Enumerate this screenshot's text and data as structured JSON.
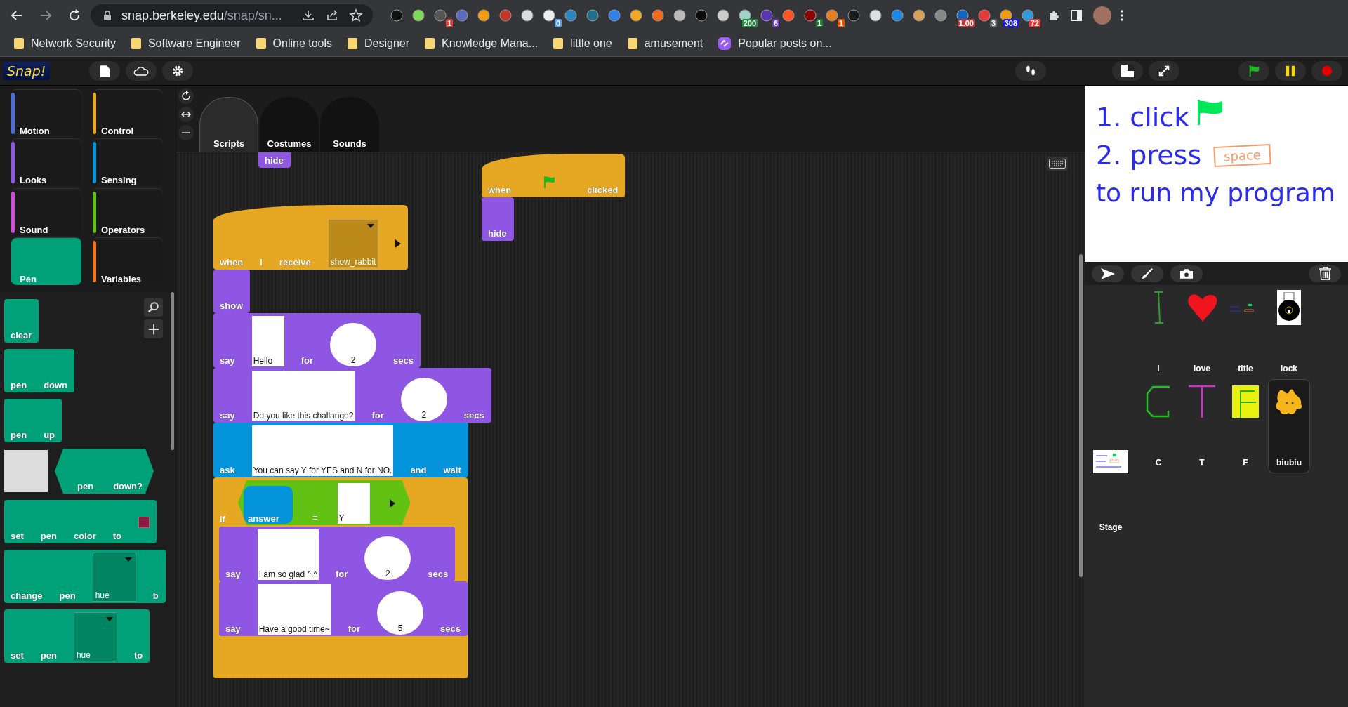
{
  "browser": {
    "url_host": "snap.berkeley.edu",
    "url_path": "/snap/sn...",
    "extensions": [
      {
        "color": "#111111"
      },
      {
        "color": "#7ed957"
      },
      {
        "color": "#555555",
        "badge": {
          "text": "1",
          "color": "#e53935"
        }
      },
      {
        "color": "#5b6bbf"
      },
      {
        "color": "#f39c12"
      },
      {
        "color": "#c0392b"
      },
      {
        "color": "#dddddd"
      },
      {
        "color": "#eeeeee",
        "badge": {
          "text": "0",
          "color": "#5b9bf0"
        }
      },
      {
        "color": "#2e86c1"
      },
      {
        "color": "#1f6f8b"
      },
      {
        "color": "#2f80ed"
      },
      {
        "color": "#f5a623"
      },
      {
        "color": "#f26b1d"
      },
      {
        "color": "#bbbbbb"
      },
      {
        "color": "#0a0a0a"
      },
      {
        "color": "#cccccc"
      },
      {
        "color": "#9fd3c7",
        "badge": {
          "text": "200",
          "color": "#1e8e3e"
        }
      },
      {
        "color": "#5e35b1",
        "badge": {
          "text": "6",
          "color": "#6a3fc1"
        }
      },
      {
        "color": "#ff5722"
      },
      {
        "color": "#8b0000",
        "badge": {
          "text": "1",
          "color": "#1e7e34"
        }
      },
      {
        "color": "#e67e22",
        "badge": {
          "text": "1",
          "color": "#e65100"
        }
      },
      {
        "color": "#1a1a1a"
      },
      {
        "color": "#e0e0e0"
      },
      {
        "color": "#1e88e5"
      },
      {
        "color": "#d4a05a"
      },
      {
        "color": "#888888"
      },
      {
        "color": "#1565c0",
        "badge": {
          "text": "1.00",
          "color": "#b03a3a"
        }
      },
      {
        "color": "#e53935",
        "badge": {
          "text": "3",
          "color": "#616161"
        }
      },
      {
        "color": "#f39c12",
        "badge": {
          "text": "308",
          "color": "#1a1aff"
        }
      },
      {
        "color": "#3498db",
        "badge": {
          "text": "72",
          "color": "#e53935"
        }
      }
    ],
    "bookmarks": [
      {
        "label": "Network Security",
        "kind": "folder"
      },
      {
        "label": "Software Engineer",
        "kind": "folder"
      },
      {
        "label": "Online tools",
        "kind": "folder"
      },
      {
        "label": "Designer",
        "kind": "folder"
      },
      {
        "label": "Knowledge Mana...",
        "kind": "folder"
      },
      {
        "label": "little one",
        "kind": "folder"
      },
      {
        "label": "amusement",
        "kind": "folder"
      },
      {
        "label": "Popular posts on...",
        "kind": "site"
      }
    ]
  },
  "snap": {
    "logo": "Snap!",
    "categories": [
      {
        "label": "Motion",
        "color": "#4a6cd4",
        "selected": false
      },
      {
        "label": "Control",
        "color": "#e6a822",
        "selected": false
      },
      {
        "label": "Looks",
        "color": "#8f56e3",
        "selected": false
      },
      {
        "label": "Sensing",
        "color": "#0494dc",
        "selected": false
      },
      {
        "label": "Sound",
        "color": "#cf4ad9",
        "selected": false
      },
      {
        "label": "Operators",
        "color": "#62c213",
        "selected": false
      },
      {
        "label": "Pen",
        "color": "#00a178",
        "selected": true
      },
      {
        "label": "Variables",
        "color": "#f3761d",
        "selected": false
      }
    ],
    "palette": [
      {
        "kind": "command",
        "color": "#00a178",
        "parts": [
          {
            "kind": "word",
            "text": "clear"
          }
        ]
      },
      {
        "kind": "command",
        "color": "#00a178",
        "parts": [
          {
            "kind": "word",
            "text": "pen"
          },
          {
            "kind": "word",
            "text": "down"
          }
        ]
      },
      {
        "kind": "command",
        "color": "#00a178",
        "parts": [
          {
            "kind": "word",
            "text": "pen"
          },
          {
            "kind": "word",
            "text": "up"
          }
        ]
      },
      {
        "kind": "checkbox-predicate",
        "color": "#00a178",
        "checked": false,
        "parts": [
          {
            "kind": "word",
            "text": "pen"
          },
          {
            "kind": "word",
            "text": "down?"
          }
        ]
      },
      {
        "kind": "command",
        "color": "#00a178",
        "parts": [
          {
            "kind": "word",
            "text": "set"
          },
          {
            "kind": "word",
            "text": "pen"
          },
          {
            "kind": "word",
            "text": "color"
          },
          {
            "kind": "word",
            "text": "to"
          },
          {
            "kind": "color",
            "color": "#8b1a45"
          }
        ]
      },
      {
        "kind": "command",
        "color": "#00a178",
        "parts": [
          {
            "kind": "word",
            "text": "change"
          },
          {
            "kind": "word",
            "text": "pen"
          },
          {
            "kind": "dropdown-slot",
            "text": "hue"
          },
          {
            "kind": "word",
            "text": "b"
          }
        ]
      },
      {
        "kind": "command",
        "color": "#00a178",
        "parts": [
          {
            "kind": "word",
            "text": "set"
          },
          {
            "kind": "word",
            "text": "pen"
          },
          {
            "kind": "dropdown-slot",
            "text": "hue"
          },
          {
            "kind": "word",
            "text": "to"
          }
        ]
      }
    ],
    "tabs": [
      {
        "label": "Scripts",
        "selected": true
      },
      {
        "label": "Costumes",
        "selected": false
      },
      {
        "label": "Sounds",
        "selected": false
      }
    ],
    "scripts": [
      {
        "blocks": [
          {
            "kind": "command",
            "color": "#8f56e3",
            "parts": [
              {
                "kind": "word",
                "text": "hide"
              }
            ]
          }
        ]
      },
      {
        "blocks": [
          {
            "kind": "hat",
            "color": "#e6a822",
            "parts": [
              {
                "kind": "word",
                "text": "when"
              },
              {
                "kind": "flag"
              },
              {
                "kind": "word",
                "text": "clicked"
              }
            ]
          },
          {
            "kind": "command",
            "color": "#8f56e3",
            "parts": [
              {
                "kind": "word",
                "text": "hide"
              }
            ]
          }
        ]
      },
      {
        "blocks": [
          {
            "kind": "hat",
            "color": "#e6a822",
            "parts": [
              {
                "kind": "word",
                "text": "when"
              },
              {
                "kind": "word",
                "text": "I"
              },
              {
                "kind": "word",
                "text": "receive"
              },
              {
                "kind": "dropdown-slot",
                "text": "show_rabbit"
              },
              {
                "kind": "arrow"
              }
            ]
          },
          {
            "kind": "command",
            "color": "#8f56e3",
            "parts": [
              {
                "kind": "word",
                "text": "show"
              }
            ]
          },
          {
            "kind": "command",
            "color": "#8f56e3",
            "parts": [
              {
                "kind": "word",
                "text": "say"
              },
              {
                "kind": "text-slot",
                "text": "Hello"
              },
              {
                "kind": "word",
                "text": "for"
              },
              {
                "kind": "num-slot",
                "text": "2"
              },
              {
                "kind": "word",
                "text": "secs"
              }
            ]
          },
          {
            "kind": "command",
            "color": "#8f56e3",
            "parts": [
              {
                "kind": "word",
                "text": "say"
              },
              {
                "kind": "text-slot",
                "text": "Do you like this challange?"
              },
              {
                "kind": "word",
                "text": "for"
              },
              {
                "kind": "num-slot",
                "text": "2"
              },
              {
                "kind": "word",
                "text": "secs"
              }
            ]
          },
          {
            "kind": "command",
            "color": "#0494dc",
            "parts": [
              {
                "kind": "word",
                "text": "ask"
              },
              {
                "kind": "text-slot",
                "text": "You can say Y for YES and N for NO."
              },
              {
                "kind": "word",
                "text": "and"
              },
              {
                "kind": "word",
                "text": "wait"
              }
            ]
          },
          {
            "kind": "c-block",
            "color": "#e6a822",
            "parts": [
              {
                "kind": "word",
                "text": "if"
              },
              {
                "kind": "predicate",
                "parts": [
                  {
                    "kind": "reporter",
                    "text": "answer"
                  },
                  {
                    "kind": "word",
                    "text": "="
                  },
                  {
                    "kind": "text-slot",
                    "text": "Y"
                  },
                  {
                    "kind": "arrow"
                  }
                ]
              }
            ],
            "children": [
              {
                "kind": "command",
                "color": "#8f56e3",
                "parts": [
                  {
                    "kind": "word",
                    "text": "say"
                  },
                  {
                    "kind": "text-slot",
                    "text": "I am so glad ^.^"
                  },
                  {
                    "kind": "word",
                    "text": "for"
                  },
                  {
                    "kind": "num-slot",
                    "text": "2"
                  },
                  {
                    "kind": "word",
                    "text": "secs"
                  }
                ]
              },
              {
                "kind": "command",
                "color": "#8f56e3",
                "parts": [
                  {
                    "kind": "word",
                    "text": "say"
                  },
                  {
                    "kind": "text-slot",
                    "text": "Have a good time~"
                  },
                  {
                    "kind": "word",
                    "text": "for"
                  },
                  {
                    "kind": "num-slot",
                    "text": "5"
                  },
                  {
                    "kind": "word",
                    "text": "secs"
                  }
                ]
              }
            ]
          }
        ]
      }
    ],
    "stage": {
      "line_1": "1. click",
      "line_2": "2. press",
      "key": "space",
      "line_3": "to run my program"
    },
    "sprites": [
      {
        "name": "I",
        "kind": "letter-i",
        "selected": false
      },
      {
        "name": "love",
        "kind": "heart",
        "selected": false
      },
      {
        "name": "title",
        "kind": "title-card",
        "selected": false
      },
      {
        "name": "lock",
        "kind": "lock",
        "selected": false
      },
      {
        "name": "C",
        "kind": "letter-c",
        "selected": false
      },
      {
        "name": "T",
        "kind": "letter-t",
        "selected": false
      },
      {
        "name": "F",
        "kind": "letter-f",
        "selected": false
      },
      {
        "name": "biubiu",
        "kind": "creature",
        "selected": true
      }
    ],
    "stage_item": {
      "label": "Stage"
    }
  }
}
